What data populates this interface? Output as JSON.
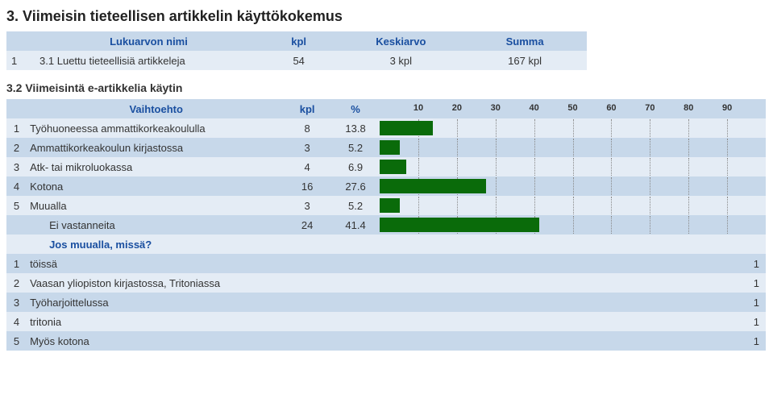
{
  "title": "3. Viimeisin tieteellisen artikkelin käyttökokemus",
  "table1": {
    "headers": {
      "c1": "Lukuarvon nimi",
      "c2": "kpl",
      "c3": "Keskiarvo",
      "c4": "Summa"
    },
    "row": {
      "idx": "1",
      "name": "3.1 Luettu tieteellisiä artikkeleja",
      "kpl": "54",
      "avg": "3 kpl",
      "sum": "167 kpl"
    }
  },
  "section2": {
    "title": "3.2 Viimeisintä e-artikkelia käytin",
    "headers": {
      "opt": "Vaihtoehto",
      "kpl": "kpl",
      "pct": "%"
    },
    "axisTicks": [
      10,
      20,
      30,
      40,
      50,
      60,
      70,
      80,
      90
    ],
    "rows": [
      {
        "idx": "1",
        "name": "Työhuoneessa ammattikorkeakoululla",
        "kpl": "8",
        "pct": "13.8",
        "val": 13.8
      },
      {
        "idx": "2",
        "name": "Ammattikorkeakoulun kirjastossa",
        "kpl": "3",
        "pct": "5.2",
        "val": 5.2
      },
      {
        "idx": "3",
        "name": "Atk- tai mikroluokassa",
        "kpl": "4",
        "pct": "6.9",
        "val": 6.9
      },
      {
        "idx": "4",
        "name": "Kotona",
        "kpl": "16",
        "pct": "27.6",
        "val": 27.6
      },
      {
        "idx": "5",
        "name": "Muualla",
        "kpl": "3",
        "pct": "5.2",
        "val": 5.2
      }
    ],
    "eiRow": {
      "name": "Ei vastanneita",
      "kpl": "24",
      "pct": "41.4",
      "val": 41.4
    },
    "josLabel": "Jos muualla, missä?",
    "freeRows": [
      {
        "idx": "1",
        "text": "töissä",
        "count": "1"
      },
      {
        "idx": "2",
        "text": "Vaasan yliopiston kirjastossa, Tritoniassa",
        "count": "1"
      },
      {
        "idx": "3",
        "text": "Työharjoittelussa",
        "count": "1"
      },
      {
        "idx": "4",
        "text": "tritonia",
        "count": "1"
      },
      {
        "idx": "5",
        "text": "Myös kotona",
        "count": "1"
      }
    ]
  },
  "chart_data": {
    "type": "bar",
    "orientation": "horizontal",
    "title": "3.2 Viimeisintä e-artikkelia käytin",
    "xlabel": "%",
    "xlim": [
      0,
      100
    ],
    "ticks": [
      10,
      20,
      30,
      40,
      50,
      60,
      70,
      80,
      90
    ],
    "categories": [
      "Työhuoneessa ammattikorkeakoululla",
      "Ammattikorkeakoulun kirjastossa",
      "Atk- tai mikroluokassa",
      "Kotona",
      "Muualla",
      "Ei vastanneita"
    ],
    "values": [
      13.8,
      5.2,
      6.9,
      27.6,
      5.2,
      41.4
    ],
    "counts": [
      8,
      3,
      4,
      16,
      3,
      24
    ]
  }
}
